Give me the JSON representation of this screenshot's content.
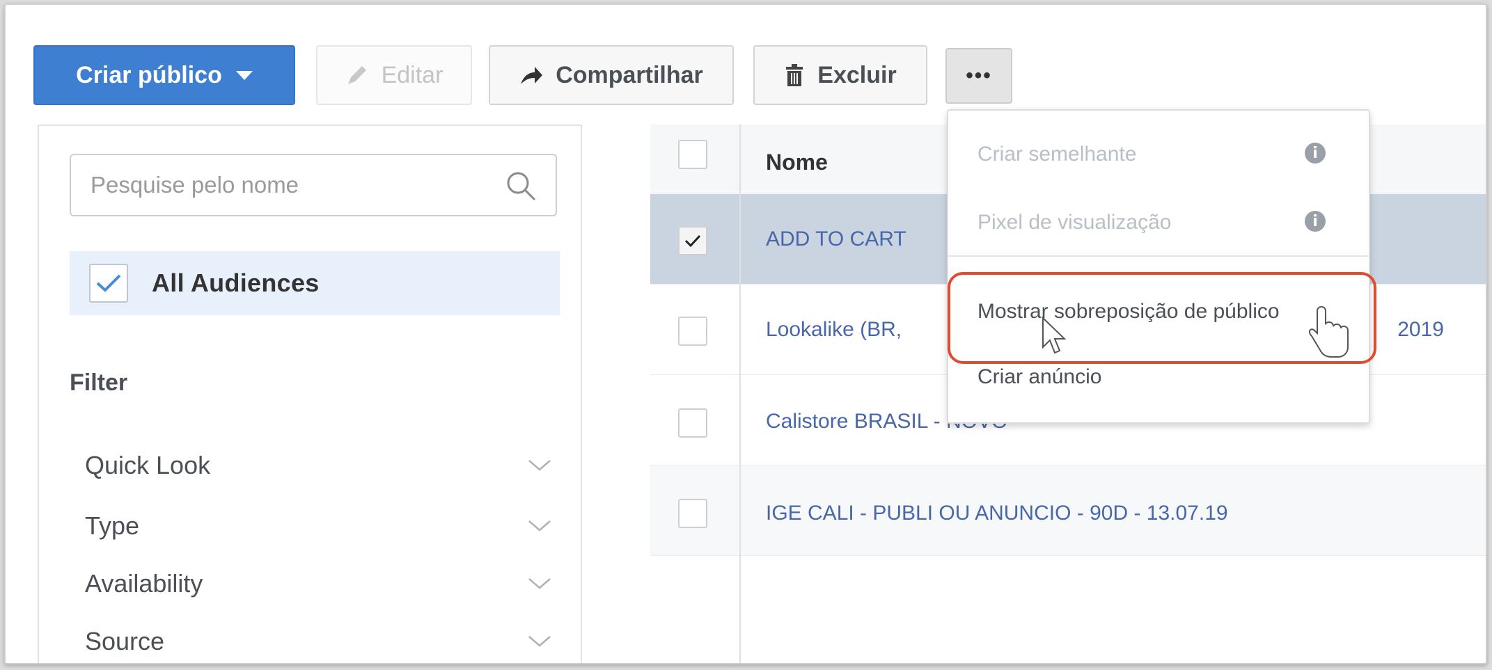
{
  "toolbar": {
    "create_label": "Criar público",
    "edit_label": "Editar",
    "share_label": "Compartilhar",
    "delete_label": "Excluir",
    "more_label": "•••"
  },
  "sidebar": {
    "search_placeholder": "Pesquise pelo nome",
    "all_audiences": "All Audiences",
    "filter_title": "Filter",
    "filters": [
      "Quick Look",
      "Type",
      "Availability",
      "Source"
    ]
  },
  "table": {
    "header_name": "Nome",
    "rows": [
      {
        "name": "ADD TO CART",
        "checked": true
      },
      {
        "name": "Lookalike (BR,",
        "trail": "2019",
        "checked": false
      },
      {
        "name": "Calistore BRASIL - NOVO",
        "checked": false
      },
      {
        "name": "IGE CALI - PUBLI OU ANUNCIO - 90D - 13.07.19",
        "checked": false
      }
    ]
  },
  "dropdown": {
    "items": [
      {
        "label": "Criar semelhante",
        "enabled": false
      },
      {
        "label": "Pixel de visualização",
        "enabled": false
      },
      {
        "label": "Mostrar sobreposição de público",
        "enabled": true
      },
      {
        "label": "Criar anúncio",
        "enabled": true
      }
    ]
  },
  "colors": {
    "primary": "#3f7fd2",
    "link": "#4867aa",
    "highlight": "#e04b32",
    "selected_row": "#c9d4e0"
  }
}
